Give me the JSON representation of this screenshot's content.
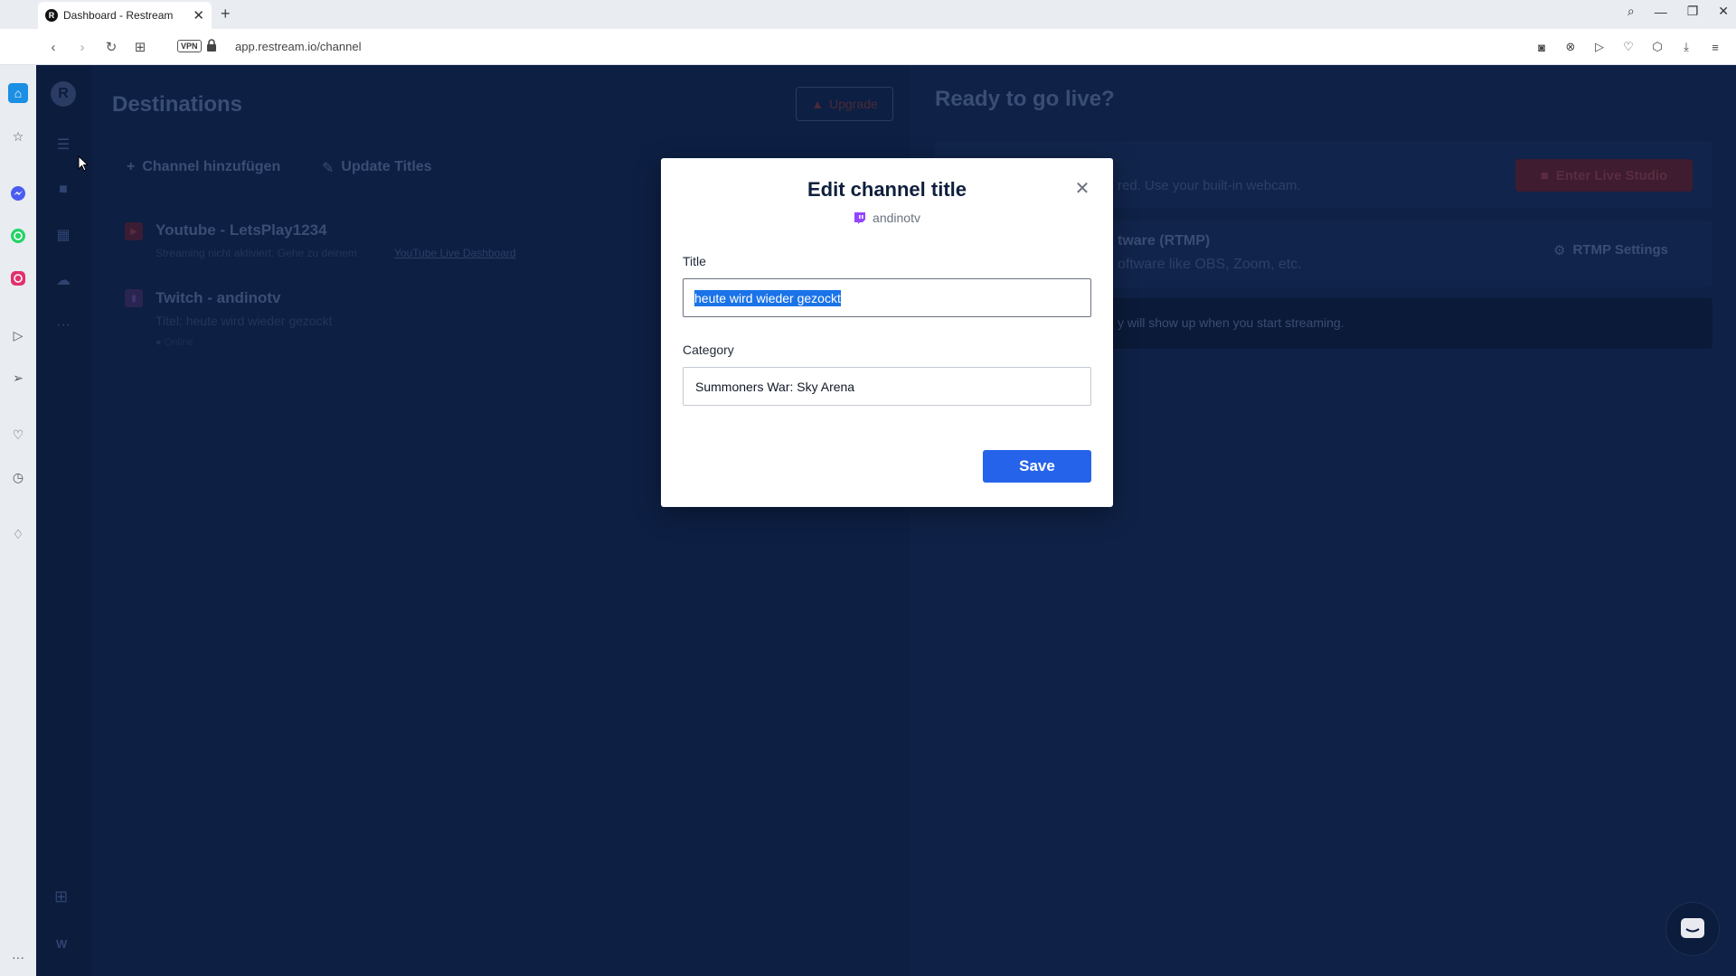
{
  "browser": {
    "tab_title": "Dashboard - Restream",
    "tab_close": "✕",
    "new_tab": "+",
    "vpn_label": "VPN",
    "url": "app.restream.io/channel"
  },
  "app": {
    "logo_letter": "R",
    "destinations_title": "Destinations",
    "upgrade_label": "Upgrade",
    "add_channel_label": "Channel hinzufügen",
    "update_titles_label": "Update Titles",
    "channels": [
      {
        "name": "Youtube - LetsPlay1234",
        "subtitle": "Streaming nicht aktiviert. Gehe zu deinem",
        "link": "YouTube Live Dashboard"
      },
      {
        "name": "Twitch - andinotv",
        "subtitle": "Titel: heute wird wieder gezockt",
        "status": "Online"
      }
    ],
    "ready_title": "Ready to go live?",
    "studio_desc": "red. Use your built-in webcam.",
    "enter_studio_label": "Enter Live Studio",
    "rtmp_title": "tware (RTMP)",
    "rtmp_desc": "oftware like OBS, Zoom, etc.",
    "rtmp_settings_label": "RTMP Settings",
    "streaming_note": "y will show up when you start streaming.",
    "bottom_letter": "W"
  },
  "modal": {
    "title": "Edit channel title",
    "channel_name": "andinotv",
    "title_label": "Title",
    "title_value": "heute wird wieder gezockt",
    "category_label": "Category",
    "category_value": "Summoners War: Sky Arena",
    "save_label": "Save"
  },
  "colors": {
    "background": "#0f2146",
    "save_button": "#2563eb",
    "twitch": "#9146ff",
    "selection": "#1a73e8"
  }
}
